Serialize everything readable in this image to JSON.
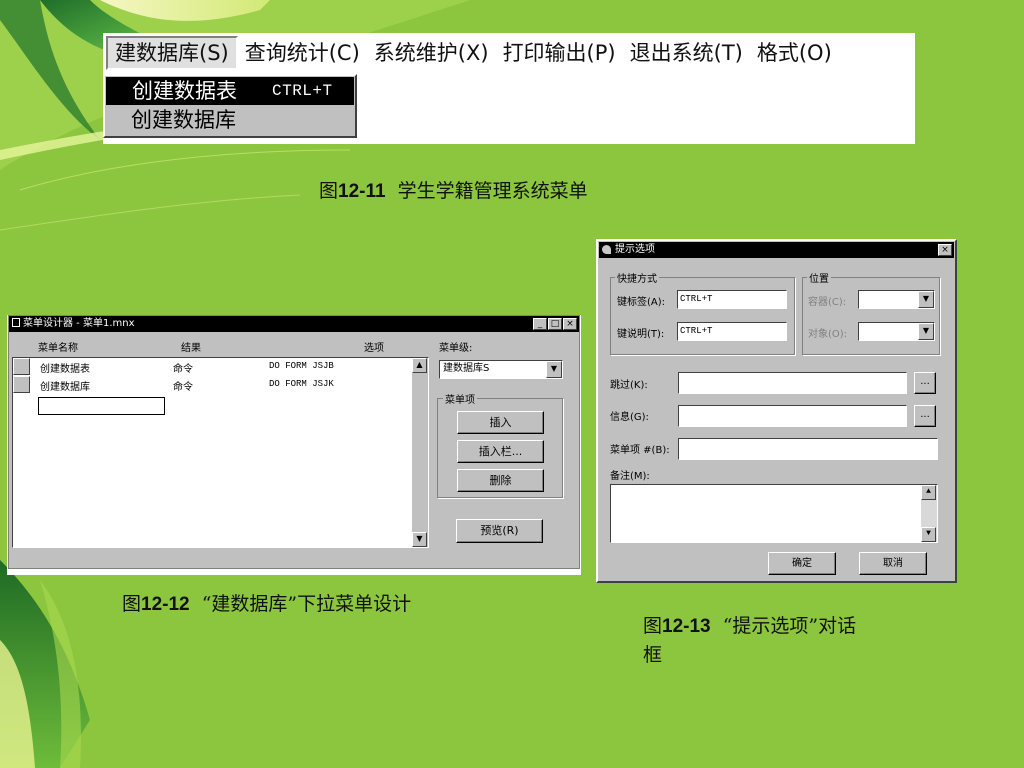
{
  "fig11": {
    "menubar": [
      "建数据库(S)",
      "查询统计(C)",
      "系统维护(X)",
      "打印输出(P)",
      "退出系统(T)",
      "格式(O)"
    ],
    "dropdown": [
      {
        "label": "创建数据表",
        "shortcut": "CTRL+T",
        "selected": true
      },
      {
        "label": "创建数据库",
        "shortcut": "",
        "selected": false
      }
    ],
    "caption_prefix": "图",
    "caption_num": "12-11",
    "caption_text": "学生学籍管理系统菜单"
  },
  "fig12": {
    "title": "菜单设计器 - 菜单1.mnx",
    "window_buttons": [
      "_",
      "□",
      "×"
    ],
    "columns": [
      "菜单名称",
      "结果",
      "选项"
    ],
    "rows": [
      {
        "name": "创建数据表",
        "result": "命令",
        "command": "DO FORM JSJB"
      },
      {
        "name": "创建数据库",
        "result": "命令",
        "command": "DO FORM JSJK"
      }
    ],
    "menu_level_label": "菜单级:",
    "menu_level_value": "建数据库S",
    "menu_item_group": "菜单项",
    "insert": "插入",
    "insert_bar": "插入栏...",
    "delete": "删除",
    "preview": "预览(R)",
    "caption_prefix": "图",
    "caption_num": "12-12",
    "caption_text": "“建数据库”下拉菜单设计"
  },
  "fig13": {
    "title": "提示选项",
    "shortcut_group": "快捷方式",
    "key_label_label": "键标签(A):",
    "key_label_value": "CTRL+T",
    "key_text_label": "键说明(T):",
    "key_text_value": "CTRL+T",
    "position_group": "位置",
    "container_label": "容器(C):",
    "object_label": "对象(O):",
    "skip_label": "跳过(K):",
    "message_label": "信息(G):",
    "pad_label": "菜单项 #(B):",
    "comment_label": "备注(M):",
    "ok": "确定",
    "cancel": "取消",
    "ellipsis": "...",
    "caption_prefix": "图",
    "caption_num": "12-13",
    "caption_text_line1": "“提示选项”对话",
    "caption_text_line2": "框"
  },
  "colors": {
    "background": "#8cc63f",
    "titlebar": "#000000",
    "dialog": "#c0c0c0"
  }
}
